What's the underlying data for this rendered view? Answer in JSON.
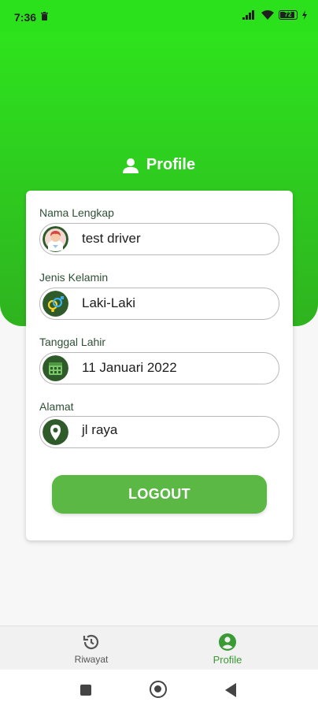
{
  "status_bar": {
    "time": "7:36",
    "battery": "72"
  },
  "page": {
    "title": "Profile"
  },
  "fields": [
    {
      "label": "Nama Lengkap",
      "value": "test driver",
      "icon": "avatar-icon"
    },
    {
      "label": "Jenis Kelamin",
      "value": "Laki-Laki",
      "icon": "gender-icon"
    },
    {
      "label": "Tanggal Lahir",
      "value": "11 Januari 2022",
      "icon": "calendar-icon"
    },
    {
      "label": "Alamat",
      "value": "jl raya",
      "icon": "location-pin-icon"
    }
  ],
  "logout_label": "LOGOUT",
  "bottom_nav": [
    {
      "label": "Riwayat",
      "icon": "history-icon",
      "active": false
    },
    {
      "label": "Profile",
      "icon": "account-circle-icon",
      "active": true
    }
  ],
  "colors": {
    "header_green": "#2be11b",
    "button_green": "#5cb845",
    "active_nav": "#3a9a33",
    "icon_dark_green": "#2f5a2a"
  }
}
